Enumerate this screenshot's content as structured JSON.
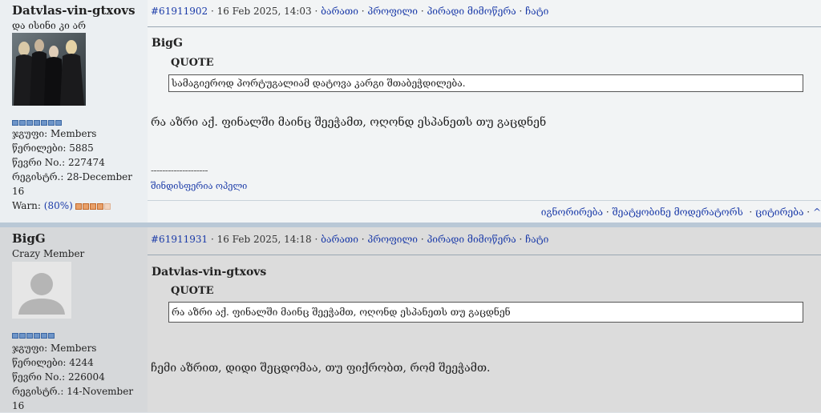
{
  "posts": [
    {
      "username": "Datvlas-vin-gtxovs",
      "user_title": "და ისინი კი არ",
      "avatar_icon": "band-photo-avatar",
      "group_label": "ჯგუფი:",
      "group": "Members",
      "posts_label": "წერილები:",
      "posts": "5885",
      "member_no_label": "წევრი No.:",
      "member_no": "227474",
      "registered_label": "რეგისტრ.:",
      "registered": "28-December 16",
      "warn_label": "Warn:",
      "warn_value": "(80%)",
      "post_id": "#61911902",
      "date": "16 Feb 2025, 14:03",
      "links": [
        "ბარათი",
        "პროფილი",
        "პირადი მიმოწერა",
        "ჩატი"
      ],
      "quote_author": "BigG",
      "quote_label": "QUOTE",
      "quote_text": "სამაგიეროდ პორტუგალიამ დატოვა კარგი შთაბეჭდილება.",
      "body": "რა აზრი აქ. ფინალში მაინც შეეჭამთ, ოღონდ ესპანეთს თუ გაცდნენ",
      "signature_sep": "--------------------",
      "signature": "შინდისფერია ოპელი"
    },
    {
      "username": "BigG",
      "user_title": "Crazy Member",
      "avatar_icon": "default-user-avatar",
      "group_label": "ჯგუფი:",
      "group": "Members",
      "posts_label": "წერილები:",
      "posts": "4244",
      "member_no_label": "წევრი No.:",
      "member_no": "226004",
      "registered_label": "რეგისტრ.:",
      "registered": "14-November 16",
      "post_id": "#61911931",
      "date": "16 Feb 2025, 14:18",
      "links": [
        "ბარათი",
        "პროფილი",
        "პირადი მიმოწერა",
        "ჩატი"
      ],
      "quote_author": "Datvlas-vin-gtxovs",
      "quote_label": "QUOTE",
      "quote_text": "რა აზრი აქ. ფინალში მაინც შეეჭამთ, ოღონდ ესპანეთს თუ გაცდნენ",
      "body": "ჩემი აზრით, დიდი შეცდომაა, თუ ფიქრობთ, რომ შეეჭამთ."
    }
  ],
  "footer": {
    "ignore": "იგნორირება",
    "report": "შეატყობინე მოდერატორს",
    "quote": "ციტირება",
    "top": "^"
  },
  "colors": {
    "link": "#1a3aa8",
    "separator": "#b9c8d6",
    "rank_dot": "#6e95c8",
    "warn_dot": "#e8a06a"
  }
}
